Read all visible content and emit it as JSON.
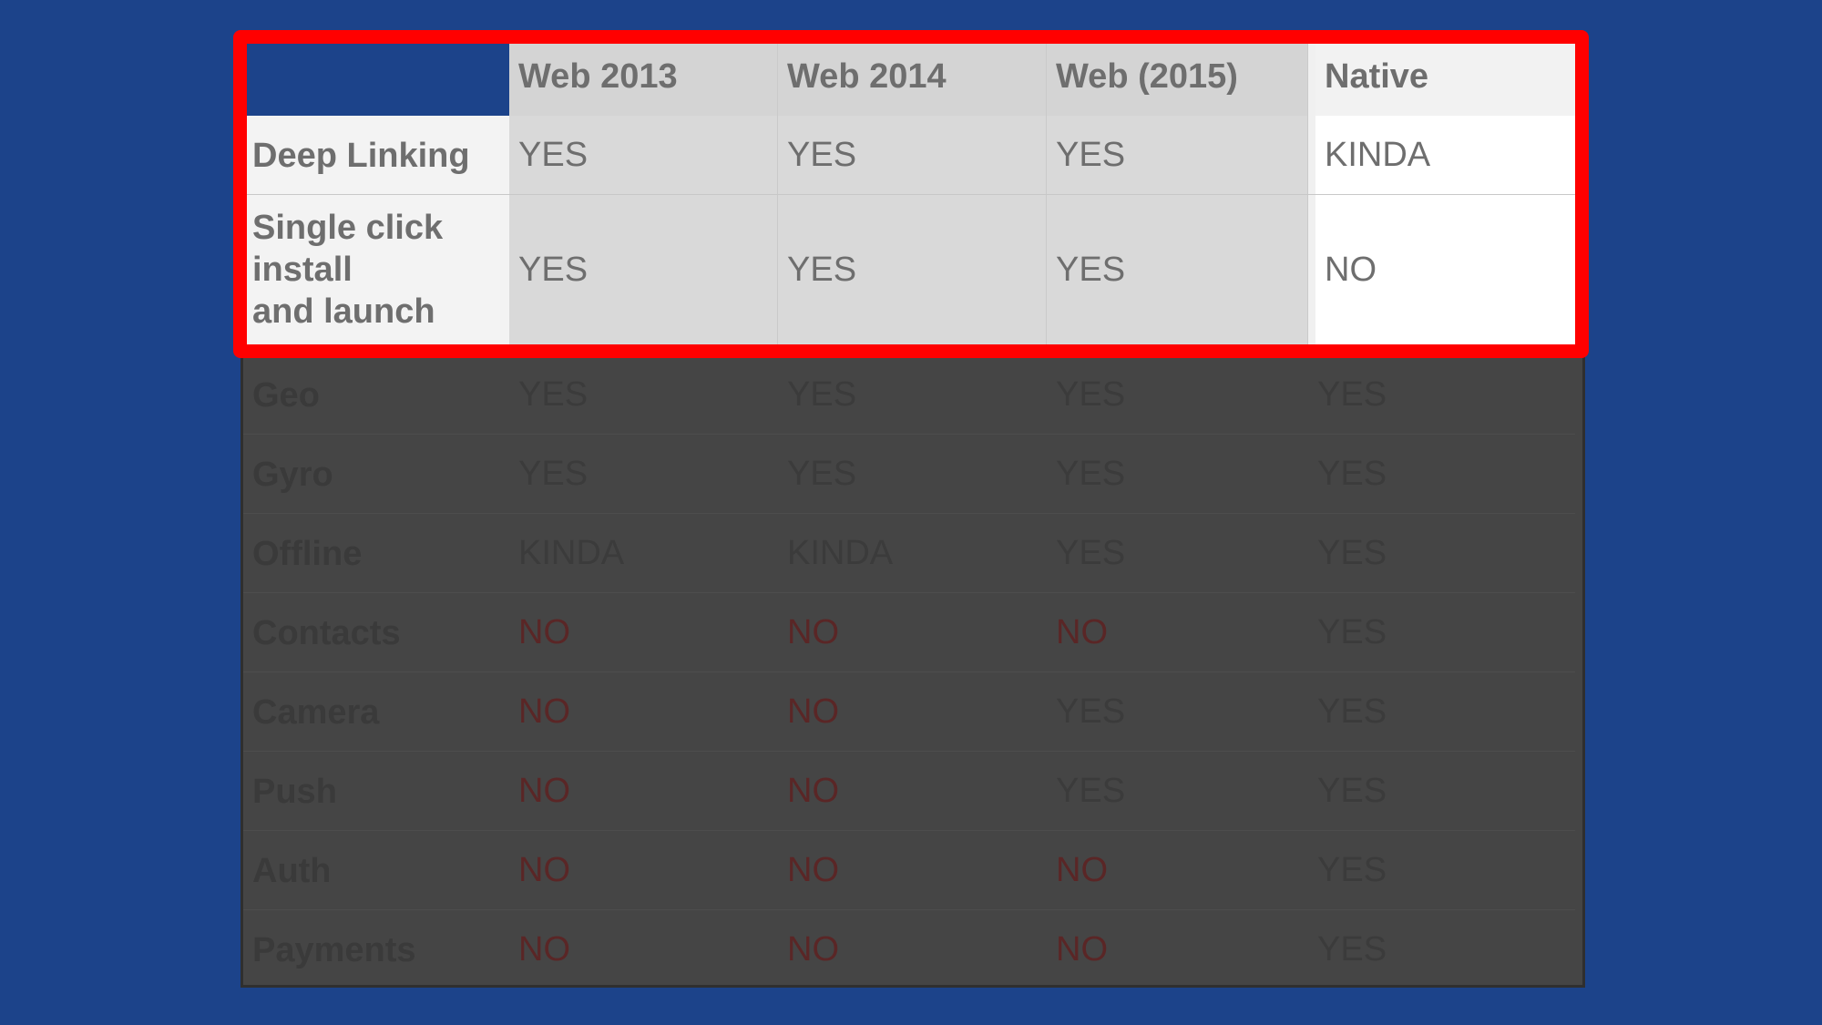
{
  "table": {
    "columns": [
      "",
      "Web 2013",
      "Web 2014",
      "Web (2015)",
      "Native"
    ],
    "highlighted_rows": [
      {
        "label": "Deep Linking",
        "values": [
          "YES",
          "YES",
          "YES",
          "KINDA"
        ]
      },
      {
        "label": "Single click install and launch",
        "label_lines": [
          "Single click",
          "install",
          "and launch"
        ],
        "values": [
          "YES",
          "YES",
          "YES",
          "NO"
        ]
      }
    ],
    "dimmed_rows": [
      {
        "label": "Geo",
        "values": [
          "YES",
          "YES",
          "YES",
          "YES"
        ]
      },
      {
        "label": "Gyro",
        "values": [
          "YES",
          "YES",
          "YES",
          "YES"
        ]
      },
      {
        "label": "Offline",
        "values": [
          "KINDA",
          "KINDA",
          "YES",
          "YES"
        ]
      },
      {
        "label": "Contacts",
        "values": [
          "NO",
          "NO",
          "NO",
          "YES"
        ]
      },
      {
        "label": "Camera",
        "values": [
          "NO",
          "NO",
          "YES",
          "YES"
        ]
      },
      {
        "label": "Push",
        "values": [
          "NO",
          "NO",
          "YES",
          "YES"
        ]
      },
      {
        "label": "Auth",
        "values": [
          "NO",
          "NO",
          "NO",
          "YES"
        ]
      },
      {
        "label": "Payments",
        "values": [
          "NO",
          "NO",
          "NO",
          "YES"
        ]
      }
    ]
  },
  "colors": {
    "background": "#1c438a",
    "highlight_frame": "#ff0000",
    "no_value_dimmed": "#5a2626"
  }
}
